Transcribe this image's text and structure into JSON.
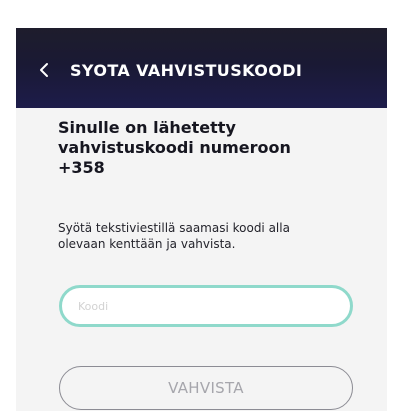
{
  "header": {
    "title": "SYOTA VAHVISTUSKOODI",
    "back_icon": "chevron-left-icon"
  },
  "main": {
    "heading_line1": "Sinulle on lähetetty",
    "heading_line2": "vahvistuskoodi numeroon",
    "heading_line3": "+358",
    "instruction_line1": "Syötä tekstiviestillä saamasi koodi alla",
    "instruction_line2": "olevaan kenttään ja vahvista.",
    "code_input": {
      "placeholder": "Koodi",
      "value": ""
    },
    "confirm_button_label": "VAHVISTA"
  },
  "colors": {
    "header_gradient": [
      "#1e1d2c",
      "#1d1c4a"
    ],
    "input_border": "#8fd9cb",
    "button_border": "#8c8c94",
    "content_background": "#f4f4f4"
  }
}
